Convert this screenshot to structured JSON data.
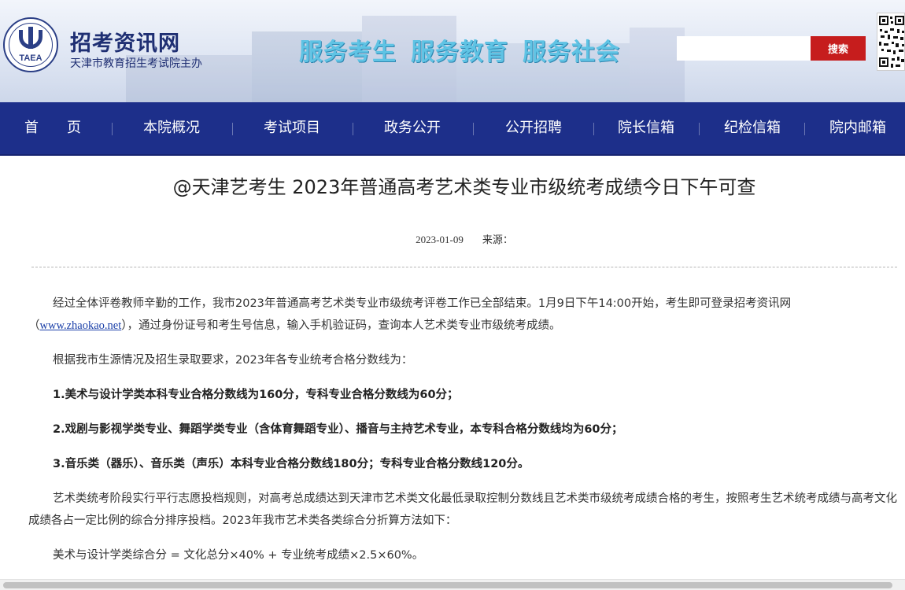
{
  "header": {
    "logo_abbr": "TAEA",
    "site_name": "招考资讯网",
    "site_sub": "天津市教育招生考试院主办",
    "slogans": [
      "服务考生",
      "服务教育",
      "服务社会"
    ],
    "search_placeholder": "",
    "search_button": "搜索"
  },
  "nav": {
    "items": [
      "首　　页",
      "本院概况",
      "考试项目",
      "政务公开",
      "公开招聘",
      "院长信箱",
      "纪检信箱",
      "院内邮箱"
    ]
  },
  "article": {
    "title": "@天津艺考生 2023年普通高考艺术类专业市级统考成绩今日下午可查",
    "date": "2023-01-09",
    "source_label": "来源：",
    "p1_a": "经过全体评卷教师辛勤的工作，我市2023年普通高考艺术类专业市级统考评卷工作已全部结束。1月9日下午14:00开始，考生即可登录招考资讯网（",
    "p1_link": "www.zhaokao.net",
    "p1_b": "），通过身份证号和考生号信息，输入手机验证码，查询本人艺术类专业市级统考成绩。",
    "p2": "根据我市生源情况及招生录取要求，2023年各专业统考合格分数线为：",
    "p3": "1.美术与设计学类本科专业合格分数线为160分，专科专业合格分数线为60分；",
    "p4": "2.戏剧与影视学类专业、舞蹈学类专业（含体育舞蹈专业）、播音与主持艺术专业，本专科合格分数线均为60分；",
    "p5": "3.音乐类（器乐）、音乐类（声乐）本科专业合格分数线180分；专科专业合格分数线120分。",
    "p6": "艺术类统考阶段实行平行志愿投档规则，对高考总成绩达到天津市艺术类文化最低录取控制分数线且艺术类市级统考成绩合格的考生，按照考生艺术统考成绩与高考文化成绩各占一定比例的综合分排序投档。2023年我市艺术类各类综合分折算方法如下：",
    "p7": "美术与设计学类综合分 = 文化总分×40% + 专业统考成绩×2.5×60%。"
  },
  "colors": {
    "nav_bg": "#1d2f8a",
    "search_button_bg": "#c61d1d",
    "slogan": "#5fc3e4",
    "brand_text": "#1f2f73"
  }
}
